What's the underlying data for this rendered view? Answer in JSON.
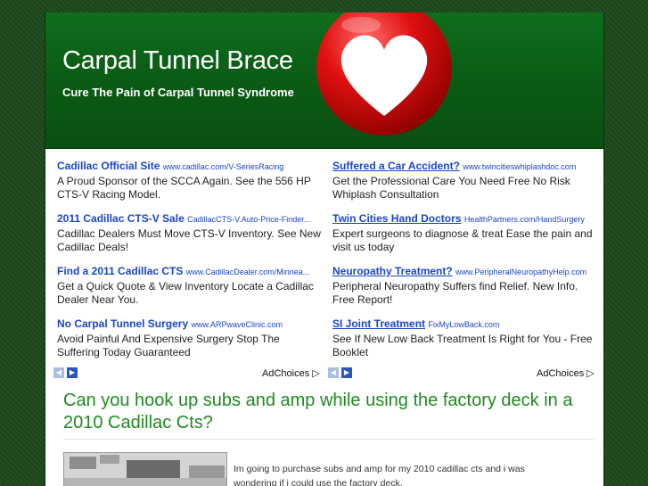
{
  "header": {
    "title": "Carpal Tunnel Brace",
    "tagline": "Cure The Pain of Carpal Tunnel Syndrome"
  },
  "ads_left": [
    {
      "title": "Cadillac Official Site",
      "url": "www.cadillac.com/V-SeriesRacing",
      "desc": "A Proud Sponsor of the SCCA Again. See the 556 HP CTS-V Racing Model."
    },
    {
      "title": "2011 Cadillac CTS-V Sale",
      "url": "CadillacCTS-V.Auto-Price-Finder...",
      "desc": "Cadillac Dealers Must Move CTS-V Inventory. See New Cadillac Deals!"
    },
    {
      "title": "Find a 2011 Cadillac CTS",
      "url": "www.CadillacDealer.com/Minnea...",
      "desc": "Get a Quick Quote & View Inventory Locate a Cadillac Dealer Near You."
    },
    {
      "title": "No Carpal Tunnel Surgery",
      "url": "www.ARPwaveClinic.com",
      "desc": "Avoid Painful And Expensive Surgery Stop The Suffering Today Guaranteed"
    }
  ],
  "ads_right": [
    {
      "title": "Suffered a Car Accident?",
      "url": "www.twincitieswhiplashdoc.com",
      "desc": "Get the Professional Care You Need Free No Risk Whiplash Consultation"
    },
    {
      "title": "Twin Cities Hand Doctors",
      "url": "HealthPartners.com/HandSurgery",
      "desc": "Expert surgeons to diagnose & treat Ease the pain and visit us today"
    },
    {
      "title": "Neuropathy Treatment?",
      "url": "www.PeripheralNeuropathyHelp.com",
      "desc": "Peripheral Neuropathy Suffers find Relief. New Info. Free Report!"
    },
    {
      "title": "SI Joint Treatment",
      "url": "FixMyLowBack.com",
      "desc": "See If New Low Back Treatment Is Right for You - Free Booklet"
    }
  ],
  "adchoices_label": "AdChoices",
  "nav": {
    "prev": "◀",
    "next": "▶"
  },
  "article": {
    "question": "Can you hook up subs and amp while using the factory deck in a 2010 Cadillac Cts?",
    "text": "Im going to purchase subs and amp for my 2010 cadillac cts and i was wondering if i could use the factory deck."
  },
  "colors": {
    "header_green": "#0a5a14",
    "ad_link": "#1a45c8",
    "question_green": "#1f8a1f"
  }
}
